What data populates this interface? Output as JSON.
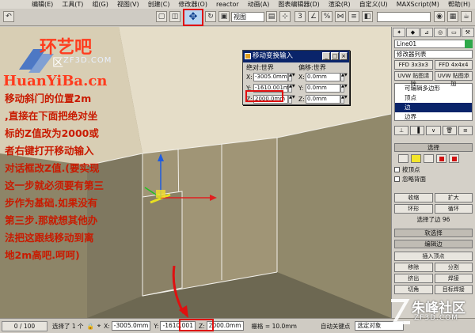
{
  "menu": [
    "编辑(E)",
    "工具(T)",
    "组(G)",
    "视图(V)",
    "创建(C)",
    "修改器(O)",
    "reactor",
    "动画(A)",
    "图表编辑器(D)",
    "渲染(R)",
    "自定义(U)",
    "MAXScript(M)",
    "帮助(H)"
  ],
  "toolbar": {
    "view_dropdown": "视图",
    "move_tool_icon": "move-icon"
  },
  "watermark": {
    "site_cn": "环艺吧",
    "site_url": "HuanYiBa.cn",
    "logo_sub": "ZF3D.COM",
    "logo_text": "区",
    "bottom_cn": "朱峰社区",
    "bottom_sub": "ZF3D.COM"
  },
  "instructions": [
    "移动斜门的位置2m",
    ",直接在下面把绝对坐",
    "标的Z值改为2000或",
    "者右键打开移动输入",
    "对话框改Z值.(要实现",
    "这一步就必须要有第三",
    "步作为基础.如果没有",
    "第三步.那就想其他办",
    "法把这跟线移动到离",
    "地2m高吧.呵呵)"
  ],
  "move_dialog": {
    "title": "移动变换输入",
    "absolute_label": "绝对:世界",
    "offset_label": "偏移:世界",
    "absolute": {
      "x": "-3005.0mm",
      "y": "-1610.001m",
      "z": "2000.0mm"
    },
    "offset": {
      "x": "0.0mm",
      "y": "0.0mm",
      "z": "0.0mm"
    },
    "axis_x": "X:",
    "axis_y": "Y:",
    "axis_z": "Z:"
  },
  "command_panel": {
    "object_name": "Line01",
    "modifier_list": "修改器列表",
    "buttons_row1": [
      "FFD 3x3x3",
      "FFD 4x4x4"
    ],
    "buttons_row2": [
      "UVW 贴图清除",
      "UVW 贴图添加"
    ],
    "stack": [
      "可编辑多边形",
      "顶点",
      "边",
      "边界"
    ],
    "stack_selected": 2,
    "rollout_select": "选择",
    "by_vertex": "按顶点",
    "ignore_backface": "忽略背面",
    "shrink": "收缩",
    "grow": "扩大",
    "ring": "环形",
    "loop": "循环",
    "selected_info": "选择了边 96",
    "rollout_soft": "软选择",
    "rollout_edit_edges": "编辑边",
    "insert_vertex": "插入顶点",
    "remove": "移除",
    "split": "分割",
    "extrude": "挤出",
    "weld": "焊接",
    "chamfer": "切角",
    "target_weld": "目标焊接"
  },
  "statusbar": {
    "time": "0 / 100",
    "selected": "选择了 1 个",
    "x": "-3005.0mm",
    "y": "-1610.001",
    "z": "2000.0mm",
    "grid": "栅格 = 10.0mm",
    "auto_key": "自动关键点",
    "selected_object": "选定对象"
  }
}
